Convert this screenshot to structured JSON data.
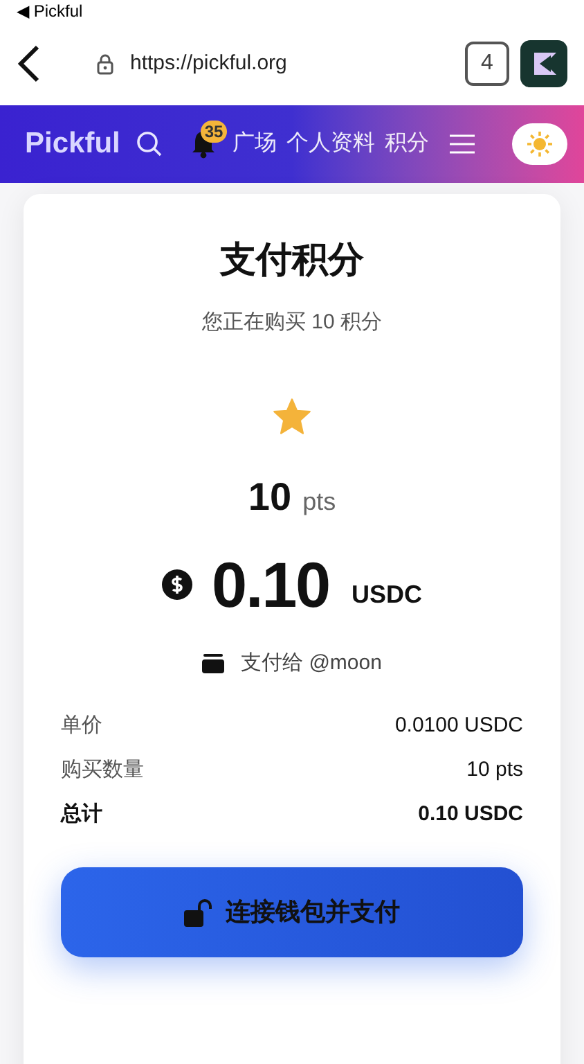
{
  "status_bar": {
    "back_label": "◀ Pickful"
  },
  "browser": {
    "url": "https://pickful.org",
    "tab_count": "4"
  },
  "nav": {
    "brand": "Pickful",
    "notification_count": "35",
    "links": [
      "广场",
      "个人资料",
      "积分"
    ]
  },
  "card": {
    "title": "支付积分",
    "subtitle": "您正在购买 10 积分",
    "points": "10",
    "points_unit": "pts",
    "amount": "0.10",
    "currency": "USDC",
    "recipient": "支付给 @moon",
    "summary": [
      {
        "label": "单价",
        "value": "0.0100 USDC",
        "kind": "normal"
      },
      {
        "label": "购买数量",
        "value": "10 pts",
        "kind": "normal"
      },
      {
        "label": "总计",
        "value": "0.10 USDC",
        "kind": "total"
      }
    ],
    "button": "连接钱包并支付"
  }
}
